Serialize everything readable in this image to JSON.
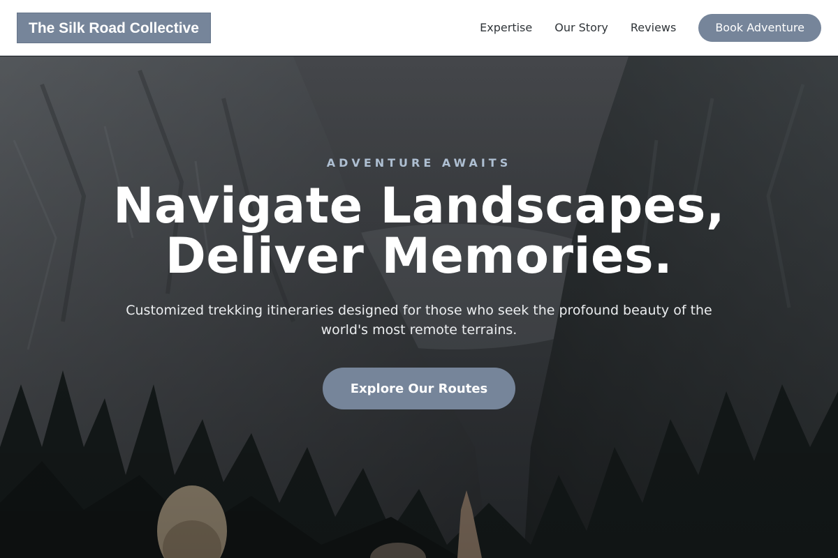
{
  "header": {
    "logo": "The Silk Road Collective",
    "nav": [
      {
        "label": "Expertise"
      },
      {
        "label": "Our Story"
      },
      {
        "label": "Reviews"
      }
    ],
    "cta_label": "Book Adventure"
  },
  "hero": {
    "eyebrow": "ADVENTURE AWAITS",
    "headline": "Navigate Landscapes, Deliver Memories.",
    "subtext": "Customized trekking itineraries designed for those who seek the profound beauty of the world's most remote terrains.",
    "cta_label": "Explore Our Routes"
  },
  "colors": {
    "accent": "#76859a",
    "eyebrow": "#aebfd2",
    "header_bg": "#ffffff",
    "text_dark": "#2f3438"
  },
  "icons": {
    "hero_image": "mountain-valley-hiker-photo"
  }
}
